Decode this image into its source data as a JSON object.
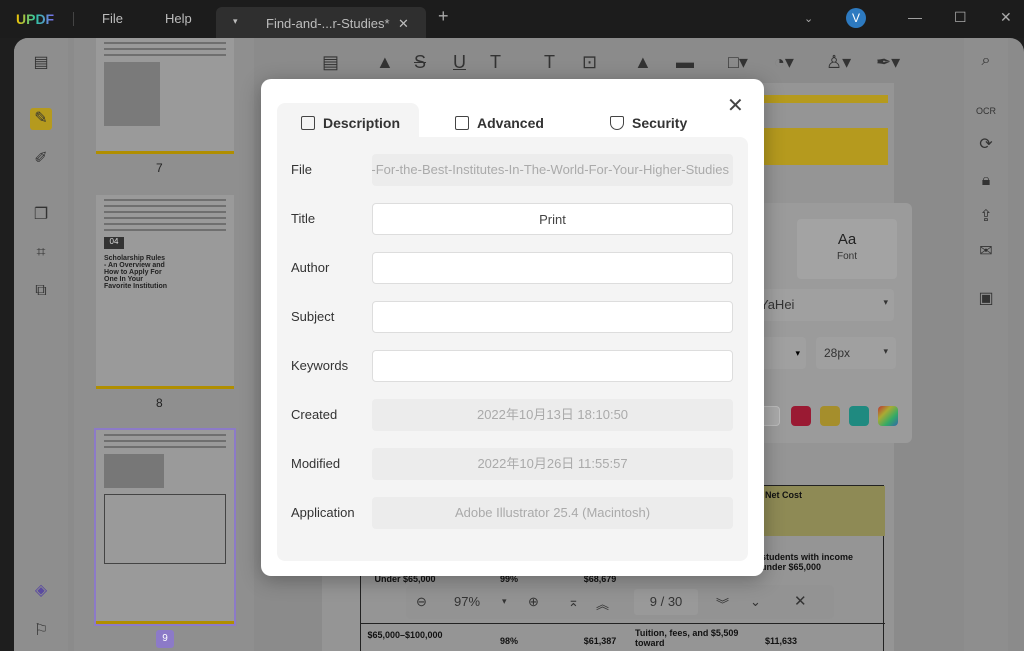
{
  "app": {
    "logo": "UPDF",
    "menu": [
      "File",
      "Help"
    ],
    "tab_title": "Find-and-...r-Studies*",
    "avatar_initial": "V"
  },
  "colors": {
    "accent": "#f5c200",
    "avatar": "#2d7ac0",
    "swatches": [
      "#ffffff",
      "#d6143c",
      "#e6c21e",
      "#1ab5a6",
      "rainbow"
    ]
  },
  "thumbnails": [
    {
      "page": "7"
    },
    {
      "page": "8",
      "heading": "Scholarship Rules - An Overview and How to Apply For One In Your Favorite Institution",
      "badge": "04"
    },
    {
      "page": "9"
    }
  ],
  "font_panel": {
    "aa": "Aa",
    "label": "Font",
    "family": "YaHei",
    "size": "28px"
  },
  "background_table": {
    "header": "Net Cost",
    "rows": [
      [
        "Under $65,000",
        "99%",
        "$68,679",
        "",
        "students with income under $65,000"
      ],
      [
        "$65,000–$100,000",
        "98%",
        "$61,387",
        "Tuition, fees, and $5,509 toward",
        "$11,633"
      ]
    ]
  },
  "zoom_bar": {
    "zoom": "97%",
    "page_current": "9",
    "page_total": "30",
    "separator": "/"
  },
  "dialog": {
    "tabs": [
      {
        "label": "Description",
        "active": true
      },
      {
        "label": "Advanced"
      },
      {
        "label": "Security"
      }
    ],
    "fields": [
      {
        "label": "File",
        "value": "y-For-the-Best-Institutes-In-The-World-For-Your-Higher-Studies",
        "editable": false
      },
      {
        "label": "Title",
        "value": "Print",
        "editable": true
      },
      {
        "label": "Author",
        "value": "",
        "editable": true
      },
      {
        "label": "Subject",
        "value": "",
        "editable": true
      },
      {
        "label": "Keywords",
        "value": "",
        "editable": true
      },
      {
        "label": "Created",
        "value": "2022年10月13日 18:10:50",
        "editable": false
      },
      {
        "label": "Modified",
        "value": "2022年10月26日 11:55:57",
        "editable": false
      },
      {
        "label": "Application",
        "value": "Adobe Illustrator 25.4 (Macintosh)",
        "editable": false
      }
    ]
  }
}
